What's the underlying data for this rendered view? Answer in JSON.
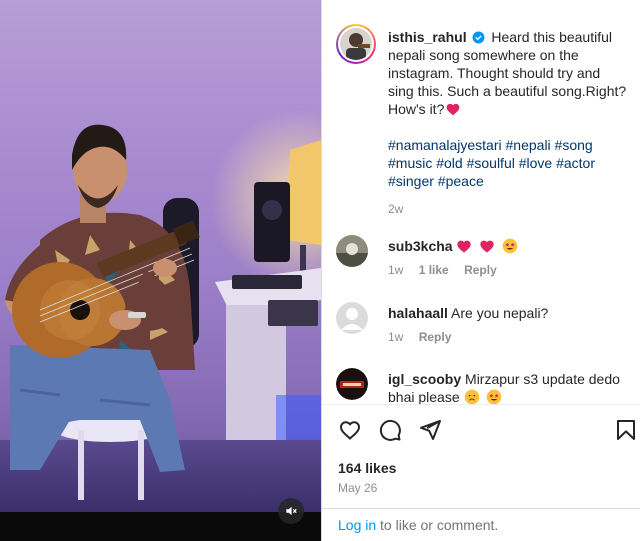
{
  "post": {
    "author": "isthis_rahul",
    "caption": "Heard this beautiful nepali song somewhere on the instagram. Thought should try and sing this. Such a beautiful song.Right? How's it?",
    "hashtags": "#namanalajyestari #nepali #song #music #old #soulful #love #actor #singer #peace",
    "age": "2w"
  },
  "comments": [
    {
      "user": "sub3kcha",
      "text": "",
      "age": "1w",
      "likes": "1 like",
      "reply": "Reply"
    },
    {
      "user": "halahaall",
      "text": "Are you nepali?",
      "age": "1w",
      "reply": "Reply"
    },
    {
      "user": "igl_scooby",
      "text": "Mirzapur s3 update dedo bhai please"
    }
  ],
  "stats": {
    "likes": "164 likes",
    "date": "May 26"
  },
  "login": {
    "link": "Log in",
    "rest": " to like or comment."
  },
  "icons": [
    "verified-icon",
    "heart-icon",
    "comment-icon",
    "share-icon",
    "bookmark-icon",
    "mute-icon"
  ],
  "colors": {
    "link": "#00376b",
    "login": "#0095f6",
    "verified": "#0095f6",
    "meta": "#8e8e8e"
  }
}
